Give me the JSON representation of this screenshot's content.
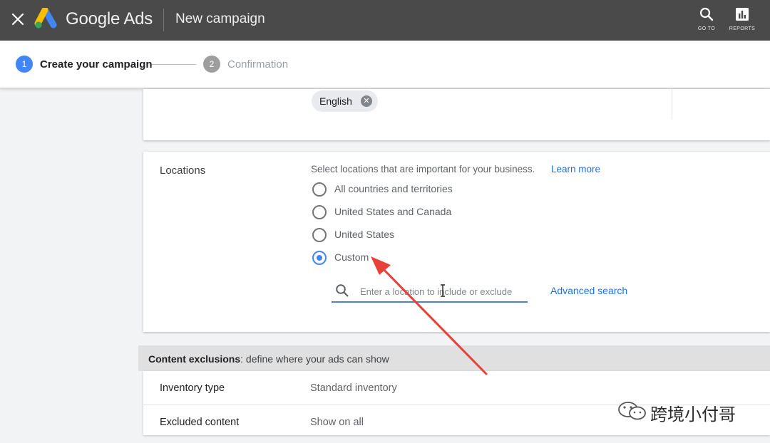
{
  "header": {
    "brand": "Google Ads",
    "page_title": "New campaign",
    "goto_label": "GO TO",
    "reports_label": "REPORTS"
  },
  "stepper": {
    "steps": [
      {
        "number": "1",
        "label": "Create your campaign",
        "active": true
      },
      {
        "number": "2",
        "label": "Confirmation",
        "active": false
      }
    ]
  },
  "languages": {
    "selected": [
      "English"
    ]
  },
  "locations": {
    "title": "Locations",
    "description": "Select locations that are important for your business.",
    "learn_more": "Learn more",
    "options": [
      {
        "label": "All countries and territories",
        "checked": false
      },
      {
        "label": "United States and Canada",
        "checked": false
      },
      {
        "label": "United States",
        "checked": false
      },
      {
        "label": "Custom",
        "checked": true
      }
    ],
    "search_placeholder": "Enter a location to include or exclude",
    "advanced_search": "Advanced search"
  },
  "content_exclusions": {
    "title_bold": "Content exclusions",
    "title_rest": ": define where your ads can show",
    "rows": [
      {
        "label": "Inventory type",
        "value": "Standard inventory"
      },
      {
        "label": "Excluded content",
        "value": "Show on all"
      }
    ]
  },
  "watermark": {
    "text": "跨境小付哥"
  },
  "colors": {
    "topbar": "#4a4a4a",
    "accent": "#4285f4",
    "link": "#1a73e8",
    "annotation_arrow": "#e8413a"
  }
}
